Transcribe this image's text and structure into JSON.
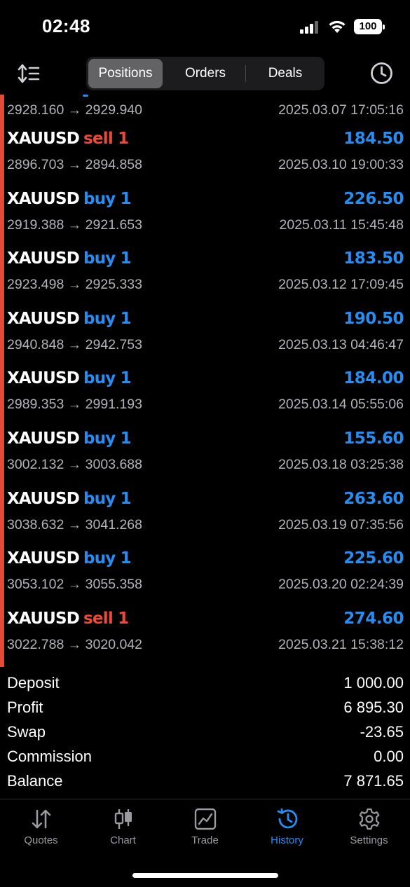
{
  "status_bar": {
    "time": "02:48",
    "battery": "100"
  },
  "nav": {
    "tabs": [
      {
        "label": "Positions",
        "active": true
      },
      {
        "label": "Orders",
        "active": false
      },
      {
        "label": "Deals",
        "active": false
      }
    ]
  },
  "first_row": {
    "prices": "2928.160 → 2929.940",
    "time": "2025.03.07 17:05:16"
  },
  "trades": [
    {
      "symbol": "XAUUSD",
      "side": "sell 1",
      "type": "sell",
      "profit": "184.50",
      "prices": "2896.703 → 2894.858",
      "time": "2025.03.10 19:00:33"
    },
    {
      "symbol": "XAUUSD",
      "side": "buy 1",
      "type": "buy",
      "profit": "226.50",
      "prices": "2919.388 → 2921.653",
      "time": "2025.03.11 15:45:48"
    },
    {
      "symbol": "XAUUSD",
      "side": "buy 1",
      "type": "buy",
      "profit": "183.50",
      "prices": "2923.498 → 2925.333",
      "time": "2025.03.12 17:09:45"
    },
    {
      "symbol": "XAUUSD",
      "side": "buy 1",
      "type": "buy",
      "profit": "190.50",
      "prices": "2940.848 → 2942.753",
      "time": "2025.03.13 04:46:47"
    },
    {
      "symbol": "XAUUSD",
      "side": "buy 1",
      "type": "buy",
      "profit": "184.00",
      "prices": "2989.353 → 2991.193",
      "time": "2025.03.14 05:55:06"
    },
    {
      "symbol": "XAUUSD",
      "side": "buy 1",
      "type": "buy",
      "profit": "155.60",
      "prices": "3002.132 → 3003.688",
      "time": "2025.03.18 03:25:38"
    },
    {
      "symbol": "XAUUSD",
      "side": "buy 1",
      "type": "buy",
      "profit": "263.60",
      "prices": "3038.632 → 3041.268",
      "time": "2025.03.19 07:35:56"
    },
    {
      "symbol": "XAUUSD",
      "side": "buy 1",
      "type": "buy",
      "profit": "225.60",
      "prices": "3053.102 → 3055.358",
      "time": "2025.03.20 02:24:39"
    },
    {
      "symbol": "XAUUSD",
      "side": "sell 1",
      "type": "sell",
      "profit": "274.60",
      "prices": "3022.788 → 3020.042",
      "time": "2025.03.21 15:38:12"
    }
  ],
  "summary": [
    {
      "label": "Deposit",
      "value": "1 000.00"
    },
    {
      "label": "Profit",
      "value": "6 895.30"
    },
    {
      "label": "Swap",
      "value": "-23.65"
    },
    {
      "label": "Commission",
      "value": "0.00"
    },
    {
      "label": "Balance",
      "value": "7 871.65"
    }
  ],
  "tabbar": [
    {
      "label": "Quotes",
      "icon": "quotes-arrows-icon",
      "active": false
    },
    {
      "label": "Chart",
      "icon": "candlestick-icon",
      "active": false
    },
    {
      "label": "Trade",
      "icon": "trade-chart-icon",
      "active": false
    },
    {
      "label": "History",
      "icon": "history-clock-icon",
      "active": true
    },
    {
      "label": "Settings",
      "icon": "gear-icon",
      "active": false
    }
  ],
  "colors": {
    "buy": "#2a8cf0",
    "sell": "#ea4a3a",
    "accent": "#2a8cf0",
    "edge": "#e54a38"
  }
}
